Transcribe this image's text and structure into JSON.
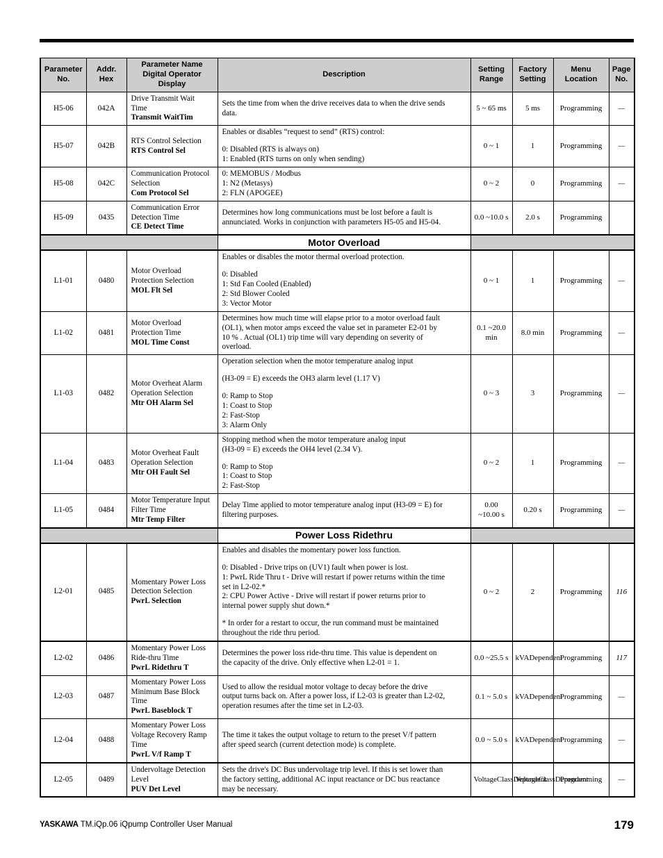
{
  "document": {
    "footer_brand": "YASKAWA",
    "footer_doc": " TM.iQp.06 iQpump Controller User Manual",
    "page_number": "179"
  },
  "table": {
    "headers": {
      "parameter_no": "Parameter\nNo.",
      "parameter_no_line1": "Parameter",
      "parameter_no_line2": "No.",
      "addr_hex_line1": "Addr.",
      "addr_hex_line2": "Hex",
      "param_name_line1": "Parameter Name",
      "param_name_line2": "Digital Operator",
      "param_name_line3": "Display",
      "description": "Description",
      "setting_range_line1": "Setting",
      "setting_range_line2": "Range",
      "factory_setting_line1": "Factory",
      "factory_setting_line2": "Setting",
      "menu_location_line1": "Menu",
      "menu_location_line2": "Location",
      "page_no_line1": "Page",
      "page_no_line2": "No."
    },
    "rows": [
      {
        "kind": "param",
        "parameter_no": "H5-06",
        "addr_hex": "042A",
        "name_plain": [
          "Drive Transmit Wait",
          "Time"
        ],
        "name_bold": "Transmit WaitTim",
        "description_lines": [
          "Sets the time from when the drive receives data to when the drive sends",
          "data."
        ],
        "setting_range": [
          "5 ~ 65 ms"
        ],
        "factory_setting": [
          "5 ms"
        ],
        "menu_location": "Programming",
        "page_no": "—"
      },
      {
        "kind": "param",
        "parameter_no": "H5-07",
        "addr_hex": "042B",
        "name_plain": [
          "RTS Control Selection"
        ],
        "name_bold": "RTS Control Sel",
        "description_lines": [
          "Enables or disables “request to send” (RTS) control:",
          "",
          "0: Disabled (RTS is always on)",
          "1: Enabled (RTS turns on only when sending)"
        ],
        "setting_range": [
          "0 ~ 1"
        ],
        "factory_setting": [
          "1"
        ],
        "menu_location": "Programming",
        "page_no": "—"
      },
      {
        "kind": "param",
        "parameter_no": "H5-08",
        "addr_hex": "042C",
        "name_plain": [
          "Communication Protocol",
          "Selection"
        ],
        "name_bold": "Com Protocol Sel",
        "description_lines": [
          "0: MEMOBUS / Modbus",
          "1: N2 (Metasys)",
          "2: FLN (APOGEE)"
        ],
        "setting_range": [
          "0 ~ 2"
        ],
        "factory_setting": [
          "0"
        ],
        "menu_location": "Programming",
        "page_no": "—"
      },
      {
        "kind": "param",
        "parameter_no": "H5-09",
        "addr_hex": "0435",
        "name_plain": [
          "Communication Error",
          "Detection Time"
        ],
        "name_bold": "CE Detect Time",
        "description_lines": [
          "Determines how long communications must be lost before a fault is",
          "annunciated. Works in conjunction with parameters H5-05 and H5-04."
        ],
        "setting_range": [
          "0.0 ~",
          "10.0 s"
        ],
        "factory_setting": [
          "2.0 s"
        ],
        "menu_location": "Programming",
        "page_no": ""
      },
      {
        "kind": "section",
        "title": "Motor Overload"
      },
      {
        "kind": "param",
        "parameter_no": "L1-01",
        "addr_hex": "0480",
        "name_plain": [
          "Motor Overload",
          "Protection Selection"
        ],
        "name_bold": "MOL Flt Sel",
        "description_lines": [
          "Enables or disables the motor thermal overload protection.",
          "",
          "0: Disabled",
          "1: Std Fan Cooled (Enabled)",
          "2: Std Blower Cooled",
          "3: Vector Motor"
        ],
        "setting_range": [
          "0 ~ 1"
        ],
        "factory_setting": [
          "1"
        ],
        "menu_location": "Programming",
        "page_no": "—"
      },
      {
        "kind": "param",
        "parameter_no": "L1-02",
        "addr_hex": "0481",
        "name_plain": [
          "Motor Overload",
          "Protection Time"
        ],
        "name_bold": "MOL Time Const",
        "description_lines": [
          "Determines how much time will elapse prior to a motor overload fault",
          "(OL1), when motor amps exceed the value set in parameter E2-01 by",
          "10 % . Actual (OL1) trip time will vary depending on severity of",
          "overload."
        ],
        "setting_range": [
          "0.1 ~",
          "20.0 min"
        ],
        "factory_setting": [
          "8.0 min"
        ],
        "menu_location": "Programming",
        "page_no": "—"
      },
      {
        "kind": "param",
        "parameter_no": "L1-03",
        "addr_hex": "0482",
        "name_plain": [
          "Motor Overheat Alarm",
          "Operation Selection"
        ],
        "name_bold": "Mtr OH Alarm Sel",
        "description_lines": [
          "Operation selection when the motor temperature analog input",
          "",
          "(H3-09 = E) exceeds the OH3 alarm level (1.17 V)",
          "",
          "0: Ramp to Stop",
          "1: Coast to Stop",
          "2: Fast-Stop",
          "3: Alarm Only"
        ],
        "setting_range": [
          "0 ~ 3"
        ],
        "factory_setting": [
          "3"
        ],
        "menu_location": "Programming",
        "page_no": "—"
      },
      {
        "kind": "param",
        "parameter_no": "L1-04",
        "addr_hex": "0483",
        "name_plain": [
          "Motor Overheat Fault",
          "Operation Selection"
        ],
        "name_bold": "Mtr OH Fault Sel",
        "description_lines": [
          "Stopping method when the motor temperature analog input",
          "(H3-09 = E) exceeds the OH4 level (2.34 V).",
          "",
          "0: Ramp to Stop",
          "1: Coast to Stop",
          "2: Fast-Stop"
        ],
        "setting_range": [
          "0 ~ 2"
        ],
        "factory_setting": [
          "1"
        ],
        "menu_location": "Programming",
        "page_no": "—"
      },
      {
        "kind": "param",
        "parameter_no": "L1-05",
        "addr_hex": "0484",
        "name_plain": [
          "Motor Temperature Input",
          "Filter Time"
        ],
        "name_bold": "Mtr Temp Filter",
        "description_lines": [
          "Delay Time applied to motor temperature analog input (H3-09 = E) for",
          "filtering purposes."
        ],
        "setting_range": [
          "0.00 ~",
          "10.00 s"
        ],
        "factory_setting": [
          "0.20 s"
        ],
        "menu_location": "Programming",
        "page_no": "—"
      },
      {
        "kind": "section",
        "title": "Power Loss Ridethru"
      },
      {
        "kind": "param",
        "parameter_no": "L2-01",
        "addr_hex": "0485",
        "name_plain": [
          "Momentary Power Loss",
          "Detection Selection"
        ],
        "name_bold": "PwrL Selection",
        "description_lines": [
          "Enables and disables the momentary power loss function.",
          "",
          "0: Disabled - Drive trips on (UV1) fault when power is lost.",
          "1: PwrL Ride Thru t - Drive will restart if power returns within the time",
          "set in L2-02.*",
          "2: CPU Power Active - Drive will restart if power returns prior to",
          "internal power supply shut down.*",
          "",
          "* In order for a restart to occur, the run command must be maintained",
          "throughout the ride thru period."
        ],
        "setting_range": [
          "0 ~ 2"
        ],
        "factory_setting": [
          "2"
        ],
        "menu_location": "Programming",
        "page_no": "116"
      },
      {
        "kind": "param",
        "parameter_no": "L2-02",
        "addr_hex": "0486",
        "name_plain": [
          "Momentary Power Loss",
          "Ride-thru Time"
        ],
        "name_bold": "PwrL Ridethru T",
        "description_lines": [
          "Determines the power loss ride-thru time. This value is dependent on",
          "the capacity of the drive. Only effective when L2-01 = 1."
        ],
        "setting_range": [
          "0.0 ~",
          "25.5 s"
        ],
        "factory_setting": [
          "kVA",
          "Dependent"
        ],
        "menu_location": "Programming",
        "page_no": "117"
      },
      {
        "kind": "param",
        "parameter_no": "L2-03",
        "addr_hex": "0487",
        "name_plain": [
          "Momentary Power Loss",
          "Minimum Base Block",
          "Time"
        ],
        "name_bold": "PwrL Baseblock T",
        "description_lines": [
          "Used to allow the residual motor voltage to decay before the drive",
          "output turns back on. After a power loss, if L2-03 is greater than L2-02,",
          "operation resumes after the time set in L2-03."
        ],
        "setting_range": [
          "0.1 ~ 5.0 s"
        ],
        "factory_setting": [
          "kVA",
          "Dependent"
        ],
        "menu_location": "Programming",
        "page_no": "—"
      },
      {
        "kind": "param",
        "parameter_no": "L2-04",
        "addr_hex": "0488",
        "name_plain": [
          "Momentary Power Loss",
          "Voltage Recovery Ramp",
          "Time"
        ],
        "name_bold": "PwrL V/f Ramp T",
        "description_lines": [
          "The time it takes the output voltage to return to the preset V/f pattern",
          "after speed search (current detection mode) is complete."
        ],
        "setting_range": [
          "0.0 ~ 5.0 s"
        ],
        "factory_setting": [
          "kVA",
          "Dependent"
        ],
        "menu_location": "Programming",
        "page_no": "—"
      },
      {
        "kind": "param",
        "parameter_no": "L2-05",
        "addr_hex": "0489",
        "name_plain": [
          "Undervoltage Detection",
          "Level"
        ],
        "name_bold": "PUV Det Level",
        "description_lines": [
          "Sets the drive's DC Bus undervoltage trip level. If this is set lower than",
          "the factory setting, additional AC input reactance or DC bus reactance",
          "may be necessary."
        ],
        "setting_range": [
          "Voltage",
          "Class",
          "Dependent"
        ],
        "factory_setting": [
          "Voltage",
          "Class",
          "Dependent"
        ],
        "menu_location": "Programming",
        "page_no": "—"
      }
    ]
  }
}
